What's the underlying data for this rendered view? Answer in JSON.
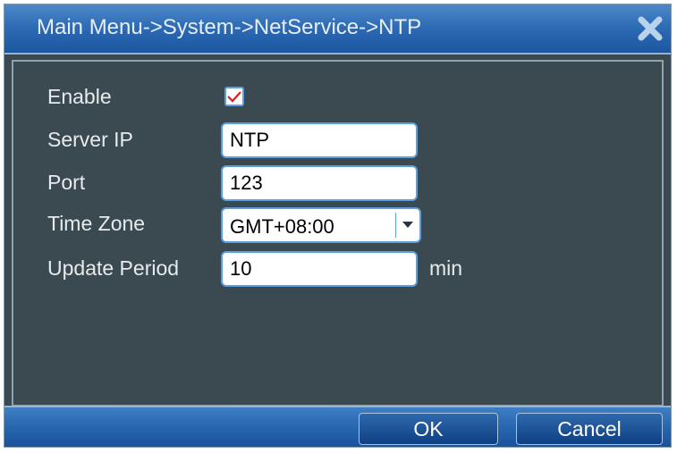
{
  "window": {
    "title": "Main Menu->System->NetService->NTP"
  },
  "form": {
    "enable": {
      "label": "Enable",
      "checked": true
    },
    "server_ip": {
      "label": "Server IP",
      "value": "NTP"
    },
    "port": {
      "label": "Port",
      "value": "123"
    },
    "time_zone": {
      "label": "Time Zone",
      "value": "GMT+08:00"
    },
    "update_period": {
      "label": "Update Period",
      "value": "10",
      "unit": "min"
    }
  },
  "footer": {
    "ok_label": "OK",
    "cancel_label": "Cancel"
  },
  "colors": {
    "title_bar": "#2e6cb5",
    "panel_bg": "#3b4a50",
    "field_border": "#5aa0e0",
    "check_mark": "#e02020"
  },
  "icons": {
    "close": "close-icon",
    "checkmark": "checkmark-icon",
    "dropdown": "chevron-down-icon"
  }
}
